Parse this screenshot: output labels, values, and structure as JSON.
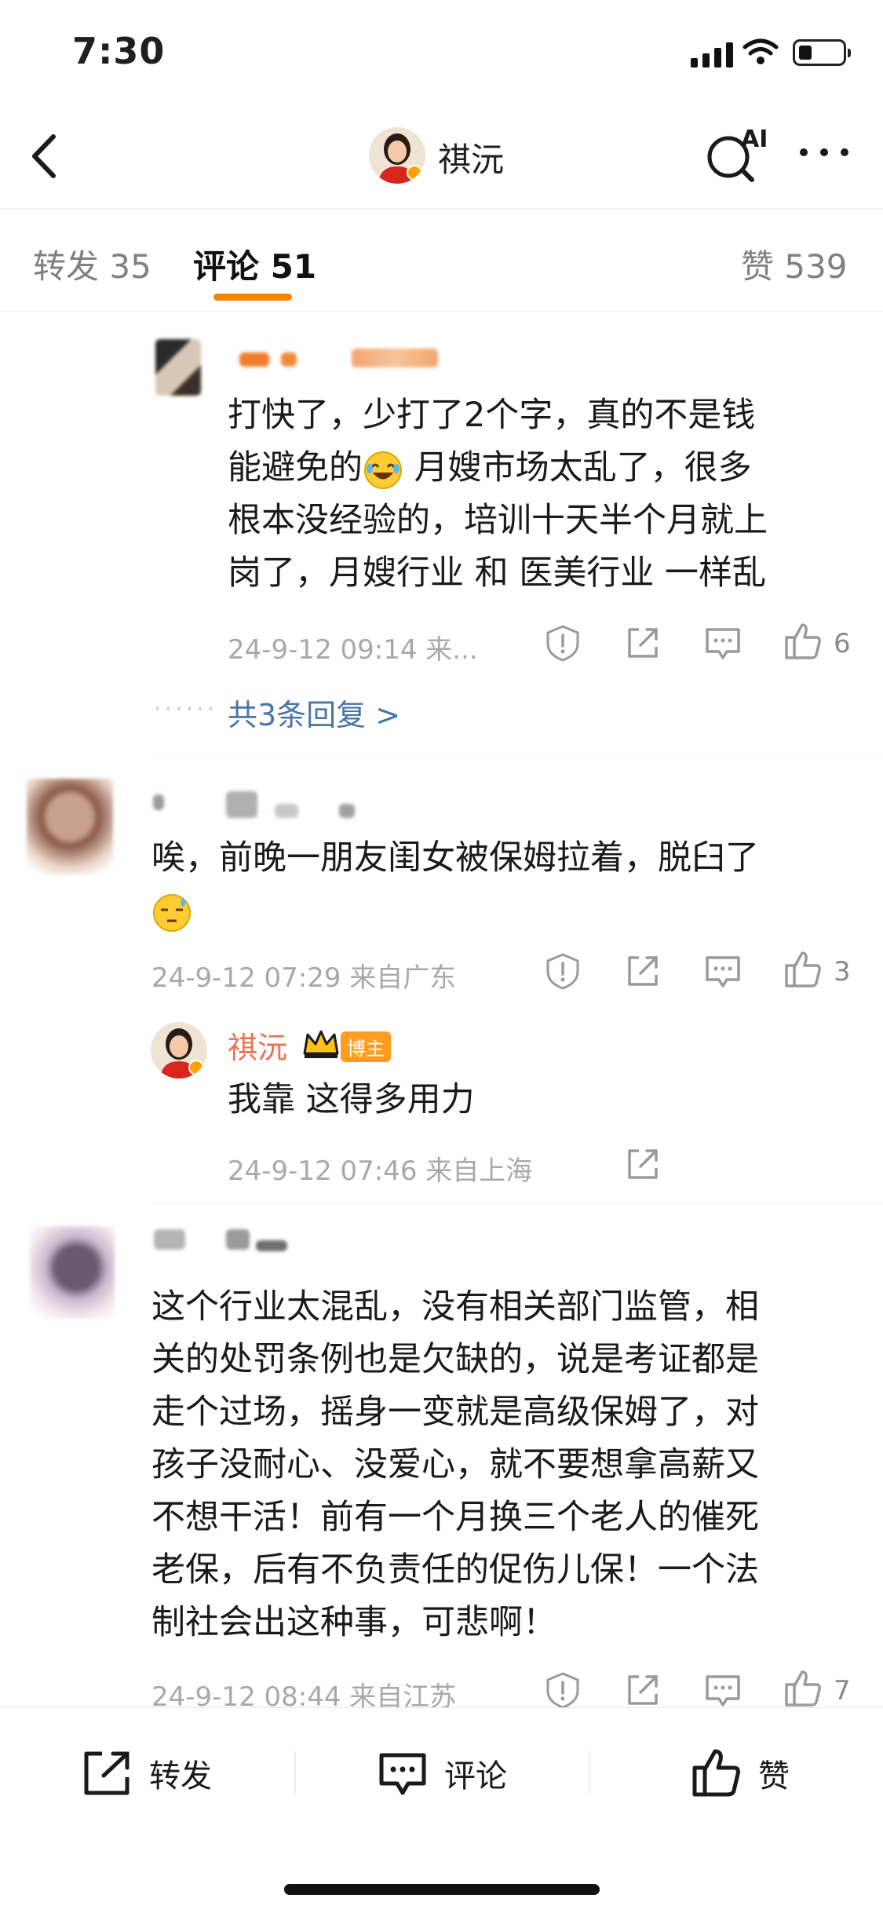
{
  "status": {
    "time": "7:30"
  },
  "header": {
    "user_name": "祺沅",
    "ai_label": "AI"
  },
  "tabs": [
    {
      "label": "转发 35"
    },
    {
      "label": "评论 51"
    },
    {
      "label": "赞 539"
    }
  ],
  "comments": [
    {
      "lines": [
        "打快了，少打了2个字，真的不是钱",
        "能避免的",
        " 月嫂市场太乱了，很多",
        "根本没经验的，培训十天半个月就上",
        "岗了，月嫂行业 和 医美行业 一样乱"
      ],
      "meta": "24-9-12 09:14 来...",
      "likes": "6",
      "more_replies": "共3条回复 >",
      "dots": "······"
    },
    {
      "lines": [
        "唉，前晚一朋友闺女被保姆拉着，脱臼了"
      ],
      "meta": "24-9-12 07:29 来自广东",
      "likes": "3",
      "reply": {
        "name": "祺沅",
        "badge": "博主",
        "text": "我靠 这得多用力",
        "meta": "24-9-12 07:46 来自上海"
      }
    },
    {
      "lines": [
        "这个行业太混乱，没有相关部门监管，相",
        "关的处罚条例也是欠缺的，说是考证都是",
        "走个过场，摇身一变就是高级保姆了，对",
        "孩子没耐心、没爱心，就不要想拿高薪又",
        "不想干活！前有一个月换三个老人的催死",
        "老保，后有不负责任的促伤儿保！一个法",
        "制社会出这种事，可悲啊！"
      ],
      "meta": "24-9-12 08:44 来自江苏",
      "likes": "7"
    }
  ],
  "bottom_bar": {
    "repost": "转发",
    "comment": "评论",
    "like": "赞"
  },
  "colors": {
    "accent": "#ff8200",
    "link": "#4a75a7",
    "vip": "#eb7350"
  }
}
